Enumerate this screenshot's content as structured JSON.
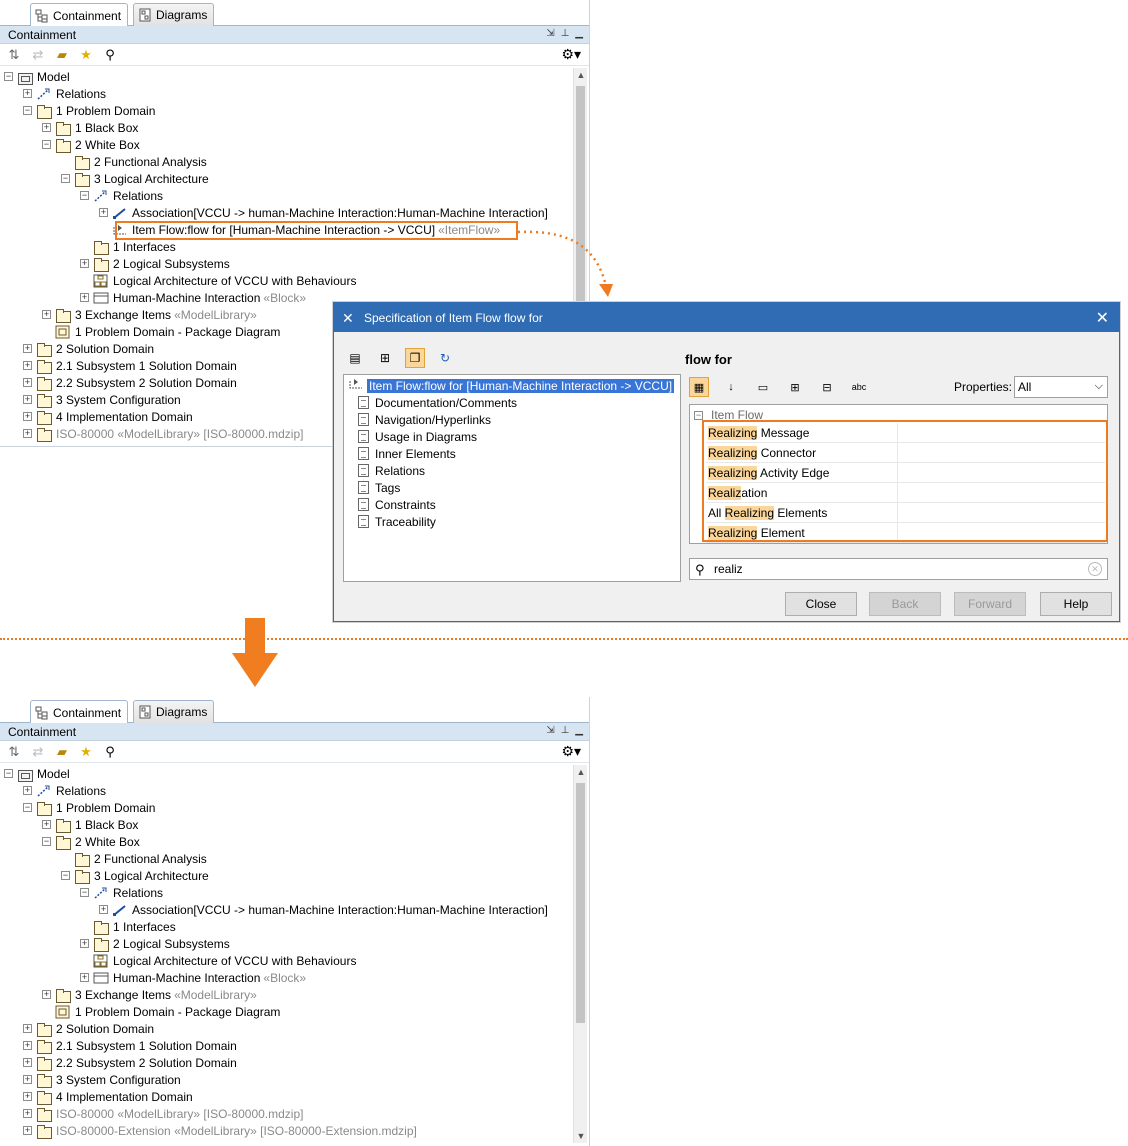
{
  "tabs": {
    "containment": "Containment",
    "diagrams": "Diagrams"
  },
  "panel_title": "Containment",
  "tree_top": [
    {
      "label": "Model",
      "indent": 0,
      "exp": "−",
      "icon": "pkg"
    },
    {
      "label": "Relations",
      "indent": 1,
      "exp": "+",
      "icon": "rel"
    },
    {
      "label": "1 Problem Domain",
      "indent": 1,
      "exp": "−",
      "icon": "folder"
    },
    {
      "label": "1 Black Box",
      "indent": 2,
      "exp": "+",
      "icon": "folder"
    },
    {
      "label": "2 White Box",
      "indent": 2,
      "exp": "−",
      "icon": "folder"
    },
    {
      "label": "2 Functional Analysis",
      "indent": 3,
      "exp": "",
      "icon": "folder"
    },
    {
      "label": "3 Logical Architecture",
      "indent": 3,
      "exp": "−",
      "icon": "folder"
    },
    {
      "label": "Relations",
      "indent": 4,
      "exp": "−",
      "icon": "rel"
    },
    {
      "label": "Association[VCCU -> human-Machine Interaction:Human-Machine Interaction]",
      "indent": 5,
      "exp": "+",
      "icon": "assoc"
    },
    {
      "label": "Item Flow:flow for [Human-Machine Interaction -> VCCU]",
      "stereo": "«ItemFlow»",
      "indent": 5,
      "exp": "",
      "icon": "flow"
    },
    {
      "label": "1 Interfaces",
      "indent": 4,
      "exp": "",
      "icon": "folder"
    },
    {
      "label": "2 Logical Subsystems",
      "indent": 4,
      "exp": "+",
      "icon": "folder"
    },
    {
      "label": "Logical Architecture of VCCU with Behaviours",
      "indent": 4,
      "exp": "",
      "icon": "diagram"
    },
    {
      "label": "Human-Machine Interaction",
      "stereo": "«Block»",
      "indent": 4,
      "exp": "+",
      "icon": "block"
    },
    {
      "label": "3 Exchange Items",
      "stereo": "«ModelLibrary»",
      "indent": 2,
      "exp": "+",
      "icon": "folder"
    },
    {
      "label": "1 Problem Domain - Package Diagram",
      "indent": 2,
      "exp": "",
      "icon": "pkgdiagram"
    },
    {
      "label": "2 Solution Domain",
      "indent": 1,
      "exp": "+",
      "icon": "folder"
    },
    {
      "label": "2.1 Subsystem 1 Solution Domain",
      "indent": 1,
      "exp": "+",
      "icon": "folder"
    },
    {
      "label": "2.2 Subsystem 2 Solution Domain",
      "indent": 1,
      "exp": "+",
      "icon": "folder"
    },
    {
      "label": "3 System Configuration",
      "indent": 1,
      "exp": "+",
      "icon": "folder"
    },
    {
      "label": "4 Implementation Domain",
      "indent": 1,
      "exp": "+",
      "icon": "folder"
    },
    {
      "label": "ISO-80000 «ModelLibrary» [ISO-80000.mdzip]",
      "indent": 1,
      "exp": "+",
      "icon": "folder",
      "gray": true
    }
  ],
  "tree_bottom": [
    {
      "label": "Model",
      "indent": 0,
      "exp": "−",
      "icon": "pkg"
    },
    {
      "label": "Relations",
      "indent": 1,
      "exp": "+",
      "icon": "rel"
    },
    {
      "label": "1 Problem Domain",
      "indent": 1,
      "exp": "−",
      "icon": "folder"
    },
    {
      "label": "1 Black Box",
      "indent": 2,
      "exp": "+",
      "icon": "folder"
    },
    {
      "label": "2 White Box",
      "indent": 2,
      "exp": "−",
      "icon": "folder"
    },
    {
      "label": "2 Functional Analysis",
      "indent": 3,
      "exp": "",
      "icon": "folder"
    },
    {
      "label": "3 Logical Architecture",
      "indent": 3,
      "exp": "−",
      "icon": "folder"
    },
    {
      "label": "Relations",
      "indent": 4,
      "exp": "−",
      "icon": "rel"
    },
    {
      "label": "Association[VCCU -> human-Machine Interaction:Human-Machine Interaction]",
      "indent": 5,
      "exp": "+",
      "icon": "assoc"
    },
    {
      "label": "1 Interfaces",
      "indent": 4,
      "exp": "",
      "icon": "folder"
    },
    {
      "label": "2 Logical Subsystems",
      "indent": 4,
      "exp": "+",
      "icon": "folder"
    },
    {
      "label": "Logical Architecture of VCCU with Behaviours",
      "indent": 4,
      "exp": "",
      "icon": "diagram"
    },
    {
      "label": "Human-Machine Interaction",
      "stereo": "«Block»",
      "indent": 4,
      "exp": "+",
      "icon": "block"
    },
    {
      "label": "3 Exchange Items",
      "stereo": "«ModelLibrary»",
      "indent": 2,
      "exp": "+",
      "icon": "folder"
    },
    {
      "label": "1 Problem Domain - Package Diagram",
      "indent": 2,
      "exp": "",
      "icon": "pkgdiagram"
    },
    {
      "label": "2 Solution Domain",
      "indent": 1,
      "exp": "+",
      "icon": "folder"
    },
    {
      "label": "2.1 Subsystem 1 Solution Domain",
      "indent": 1,
      "exp": "+",
      "icon": "folder"
    },
    {
      "label": "2.2 Subsystem 2 Solution Domain",
      "indent": 1,
      "exp": "+",
      "icon": "folder"
    },
    {
      "label": "3 System Configuration",
      "indent": 1,
      "exp": "+",
      "icon": "folder"
    },
    {
      "label": "4 Implementation Domain",
      "indent": 1,
      "exp": "+",
      "icon": "folder"
    },
    {
      "label": "ISO-80000 «ModelLibrary» [ISO-80000.mdzip]",
      "indent": 1,
      "exp": "+",
      "icon": "folder",
      "gray": true
    },
    {
      "label": "ISO-80000-Extension «ModelLibrary» [ISO-80000-Extension.mdzip]",
      "indent": 1,
      "exp": "+",
      "icon": "folder",
      "gray": true
    }
  ],
  "dialog": {
    "title": "Specification of Item Flow flow for",
    "heading": "flow for",
    "nav": [
      "Item Flow:flow for [Human-Machine Interaction -> VCCU]",
      "Documentation/Comments",
      "Navigation/Hyperlinks",
      "Usage in Diagrams",
      "Inner Elements",
      "Relations",
      "Tags",
      "Constraints",
      "Traceability"
    ],
    "properties_label": "Properties:",
    "properties_value": "All",
    "group": "Item Flow",
    "rows": [
      {
        "pre": "",
        "hl": "Realizing",
        "post": " Message"
      },
      {
        "pre": "",
        "hl": "Realizing",
        "post": " Connector"
      },
      {
        "pre": "",
        "hl": "Realizing",
        "post": " Activity Edge"
      },
      {
        "pre": "",
        "hl": "Realiz",
        "post": "ation"
      },
      {
        "pre": "All ",
        "hl": "Realizing",
        "post": " Elements"
      },
      {
        "pre": "",
        "hl": "Realizing",
        "post": " Element"
      }
    ],
    "search_value": "realiz",
    "buttons": {
      "close": "Close",
      "back": "Back",
      "forward": "Forward",
      "help": "Help"
    }
  },
  "colors": {
    "accent_orange": "#ee7b21",
    "title_blue": "#2f6cb3",
    "highlight": "#fbd69a"
  }
}
